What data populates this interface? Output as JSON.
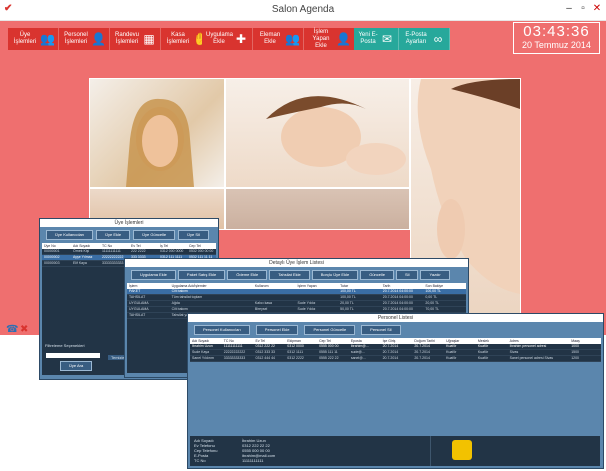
{
  "app": {
    "title": "Salon Agenda"
  },
  "window_controls": {
    "minimize": "–",
    "maximize": "▫",
    "close": "✕"
  },
  "toolbar": {
    "red_buttons": [
      {
        "label": "Üye İşlemleri",
        "icon": "people-icon"
      },
      {
        "label": "Personel İşlemleri",
        "icon": "person-icon"
      },
      {
        "label": "Randevu İşlemleri",
        "icon": "calendar-icon"
      },
      {
        "label": "Kasa İşlemleri",
        "icon": "hand-money-icon"
      }
    ],
    "red_buttons2": [
      {
        "label": "Uygulama Ekle",
        "icon": "plus-icon"
      },
      {
        "label": "Eleman Ekle",
        "icon": "group-icon"
      },
      {
        "label": "İşlem Yapan Ekle",
        "icon": "person-icon"
      }
    ],
    "teal_buttons": [
      {
        "label": "Yeni E-Posta",
        "icon": "mail-icon"
      },
      {
        "label": "E-Posta Ayarları",
        "icon": "gear-link-icon"
      }
    ]
  },
  "clock": {
    "time": "03:43:36",
    "date": "20 Temmuz 2014"
  },
  "win_uye": {
    "title": "Üye İşlemleri",
    "buttons": [
      "Üye Kullanıcıları",
      "Üye Ekle",
      "Üye Güncelle",
      "Üye Sil"
    ],
    "headers": [
      "Üye No",
      "Adı Soyadı",
      "TC No",
      "Ev Tel",
      "İş Tel",
      "Cep Tel",
      "Eposta",
      "Kayıt Tarihi",
      "Doğum Tarihi",
      "Referans",
      "Meslek",
      "Adres"
    ],
    "rows": [
      [
        "00000001",
        "Örnek Kişi",
        "11111111111",
        "222 2222",
        "0312 000 0000",
        "0532 000 00 00",
        "ornek@mail.com",
        "20.7.2014",
        "20.7.2014",
        "Arkadaş",
        "Öğrenci",
        "Sivas"
      ],
      [
        "00000002",
        "Ayşe Yılmaz",
        "22222222222",
        "333 3333",
        "0312 111 1111",
        "0532 111 11 11",
        "ayse@mail.com",
        "20.7.2014",
        "20.7.2014",
        "İnternet",
        "Memur",
        "Ankara"
      ],
      [
        "00000003",
        "Elif Kaya",
        "33333333333",
        "444 4444",
        "0312 222 2222",
        "0532 222 22 22",
        "elif@mail.com",
        "20.7.2014",
        "20.7.2014",
        "Arkadaş",
        "Serbest",
        "Sivas"
      ]
    ],
    "filter_label": "Filtreleme Seçenekleri",
    "search_button": "Üye Ara",
    "clear_button": "Temizle"
  },
  "win_islem": {
    "title": "Detaylı Üye İşlem Listesi",
    "buttons": [
      "Uygulama Ekle",
      "Paket Satış Ekle",
      "Ödeme Ekle",
      "Tahsilat Ekle",
      "Borçlu Üye Ekle",
      "Güncelle",
      "Sil",
      "Yazdır"
    ],
    "headers": [
      "İşlem",
      "Uygulama Adı/İşlemler",
      "Kullanım",
      "İşlem Yapan",
      "Tutar",
      "Tarih",
      "Son Bakiye"
    ],
    "rows": [
      [
        "PAKET",
        "Cilt bakımı",
        "",
        "",
        "100,00 TL",
        "20.7.2014 04:00:00",
        "100,00 TL"
      ],
      [
        "TAHSILAT",
        "Tüm tahsilat toplam",
        "",
        "",
        "100,00 TL",
        "20.7.2014 04:00:00",
        "0,00 TL"
      ],
      [
        "UYGULAMA",
        "Ağda",
        "Kalıcı kasa",
        "Sude Yıldız",
        "20,00 TL",
        "20.7.2014 04:00:00",
        "20,00 TL"
      ],
      [
        "UYGULAMA",
        "Cilt bakımı",
        "Bireysel",
        "Sude Yıldız",
        "50,00 TL",
        "20.7.2014 04:00:00",
        "70,00 TL"
      ],
      [
        "TAHSILAT",
        "Tahsilat yapıldı",
        "",
        "",
        "70,00 TL",
        "20.7.2014 04:00:00",
        "0,00 TL"
      ]
    ]
  },
  "win_personel": {
    "title": "Personel Listesi",
    "buttons": [
      "Personel Kullanıcıları",
      "Personel Ekle",
      "Personel Güncelle",
      "Personel Sil"
    ],
    "headers": [
      "Adı Soyadı",
      "TC No",
      "Ev Tel",
      "Ekipman",
      "Cep Tel",
      "Eposta",
      "İşe Giriş",
      "Doğum Tarihi",
      "Uğraşlar",
      "Meslek",
      "Adres",
      "Maaş"
    ],
    "rows": [
      [
        "İbrahim Uzun",
        "11111111111",
        "0312 222 22",
        "0312 0000",
        "0555 000 00",
        "ibrahim@...",
        "20.7.2014",
        "20.7.2014",
        "Kuaför",
        "Kuaför",
        "İbrahim personel adresi",
        "1000"
      ],
      [
        "Sude Kaya",
        "22222222222",
        "0312 333 33",
        "0312 1111",
        "0555 111 11",
        "sude@...",
        "20.7.2014",
        "20.7.2014",
        "Kuaför",
        "Kuaför",
        "Sivas",
        "1500"
      ],
      [
        "Sanel Yıldırım",
        "33333333333",
        "0312 444 44",
        "0312 2222",
        "0555 222 22",
        "sanel@...",
        "20.7.2014",
        "20.7.2014",
        "Kuaför",
        "Kuaför",
        "Sanel personel adresi Sivas",
        "1200"
      ]
    ],
    "detail_labels": [
      "Adı Soyadı",
      "Ev Telefonu",
      "Cep Telefonu",
      "E-Posta",
      "TC No",
      "Adres"
    ],
    "detail_values": [
      "İbrahim Uzun",
      "0312 222 22 22",
      "0555 000 00 00",
      "ibrahim@mail.com",
      "11111111111",
      "İbrahim personel adresi Sivas / Ankara"
    ]
  }
}
